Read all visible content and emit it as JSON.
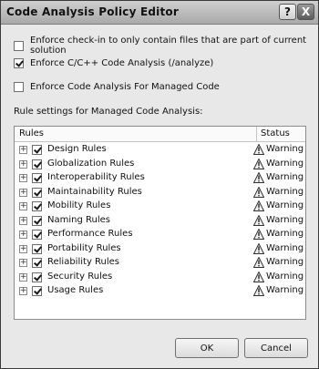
{
  "window": {
    "title": "Code Analysis Policy Editor",
    "help_glyph": "?",
    "close_glyph": "X"
  },
  "options": [
    {
      "label": "Enforce check-in to only contain files that are part of current solution",
      "checked": false
    },
    {
      "label": "Enforce C/C++ Code Analysis (/analyze)",
      "checked": true
    },
    {
      "label": "Enforce Code Analysis For Managed Code",
      "checked": false
    }
  ],
  "rules_section": {
    "label": "Rule settings for Managed Code Analysis:",
    "columns": {
      "rules": "Rules",
      "status": "Status"
    },
    "expander_glyph": "+",
    "items": [
      {
        "name": "Design Rules",
        "status": "Warning"
      },
      {
        "name": "Globalization Rules",
        "status": "Warning"
      },
      {
        "name": "Interoperability Rules",
        "status": "Warning"
      },
      {
        "name": "Maintainability Rules",
        "status": "Warning"
      },
      {
        "name": "Mobility Rules",
        "status": "Warning"
      },
      {
        "name": "Naming Rules",
        "status": "Warning"
      },
      {
        "name": "Performance Rules",
        "status": "Warning"
      },
      {
        "name": "Portability Rules",
        "status": "Warning"
      },
      {
        "name": "Reliability Rules",
        "status": "Warning"
      },
      {
        "name": "Security Rules",
        "status": "Warning"
      },
      {
        "name": "Usage Rules",
        "status": "Warning"
      }
    ]
  },
  "buttons": {
    "ok": "OK",
    "cancel": "Cancel"
  }
}
